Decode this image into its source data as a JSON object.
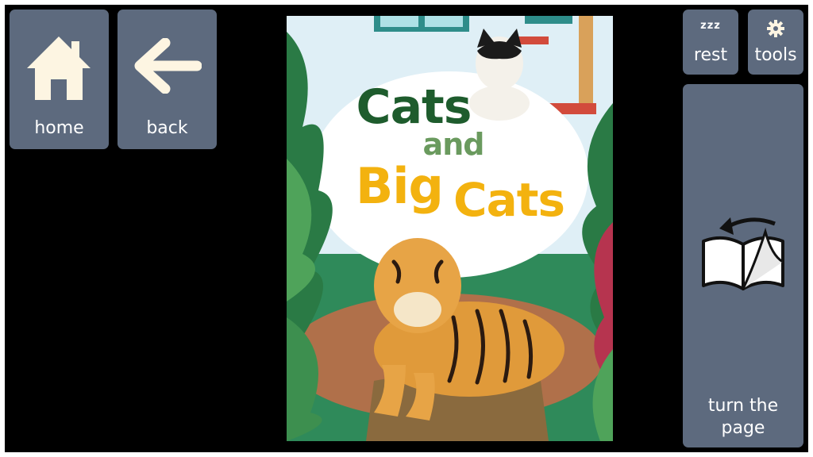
{
  "nav": {
    "home_label": "home",
    "back_label": "back",
    "rest_label": "rest",
    "rest_icon_text": "zzz",
    "tools_label": "tools",
    "turn_label_line1": "turn the",
    "turn_label_line2": "page"
  },
  "book": {
    "title_line1": "Cats",
    "title_line2": "and",
    "title_line3a": "Big",
    "title_line3b": "Cats"
  },
  "colors": {
    "button_bg": "#5d6a7e",
    "icon_cream": "#fdf5e2",
    "title_dark_green": "#1e5c2d",
    "title_light_green": "#6a9a5e",
    "title_yellow": "#f3b20f"
  },
  "icons": {
    "home": "house-icon",
    "back": "arrow-left-icon",
    "rest": "sleep-zzz-icon",
    "tools": "gear-icon",
    "turn": "open-book-turn-page-icon"
  }
}
